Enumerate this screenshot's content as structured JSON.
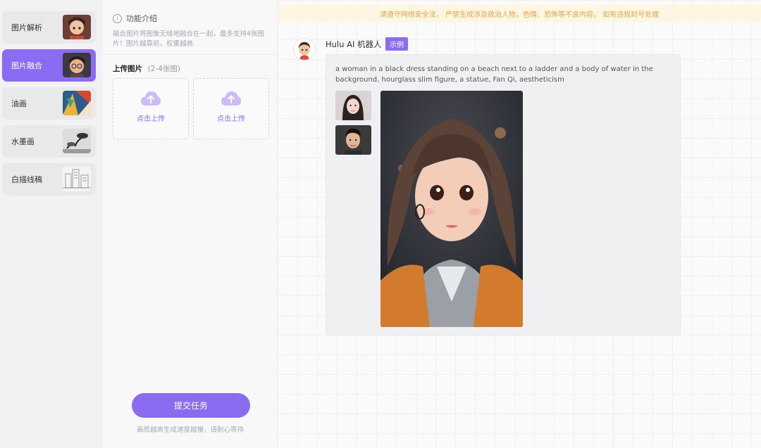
{
  "sidebar": {
    "items": [
      {
        "label": "图片解析",
        "thumb": "child-portrait"
      },
      {
        "label": "图片融合",
        "thumb": "boy-glasses-portrait",
        "active": true
      },
      {
        "label": "油画",
        "thumb": "colorful-oil-painting"
      },
      {
        "label": "水墨画",
        "thumb": "ink-tree-painting"
      },
      {
        "label": "白描线稿",
        "thumb": "line-sketch-city"
      }
    ]
  },
  "panel": {
    "intro_title": "功能介绍",
    "intro_desc": "融合图片将图像无缝地融合在一起，最多支持4张图片！图片越靠前，权重越高",
    "upload_title": "上传图片",
    "upload_sub": "(2-4张图)",
    "upload_boxes": [
      {
        "label": "点击上传"
      },
      {
        "label": "点击上传"
      }
    ],
    "submit_label": "提交任务",
    "submit_note": "画质越高生成速度越慢，请耐心等待"
  },
  "main": {
    "banner": "请遵守网络安全法，  严禁生成涉及政治人物，色情、恐怖等不良内容，  如有违规封号处理",
    "bot_name": "Hulu AI 机器人",
    "tag": "示例",
    "prompt": "a woman in a black dress standing on a beach next to a ladder and a body of water in the background, hourglass slim figure, a statue, Fan Qi, aestheticism"
  },
  "colors": {
    "accent": "#8b6cf0",
    "banner_bg": "#fdf6e2",
    "banner_text": "#e0a64a"
  },
  "icons": [
    "info-icon",
    "cloud-upload-icon",
    "bot-avatar"
  ]
}
